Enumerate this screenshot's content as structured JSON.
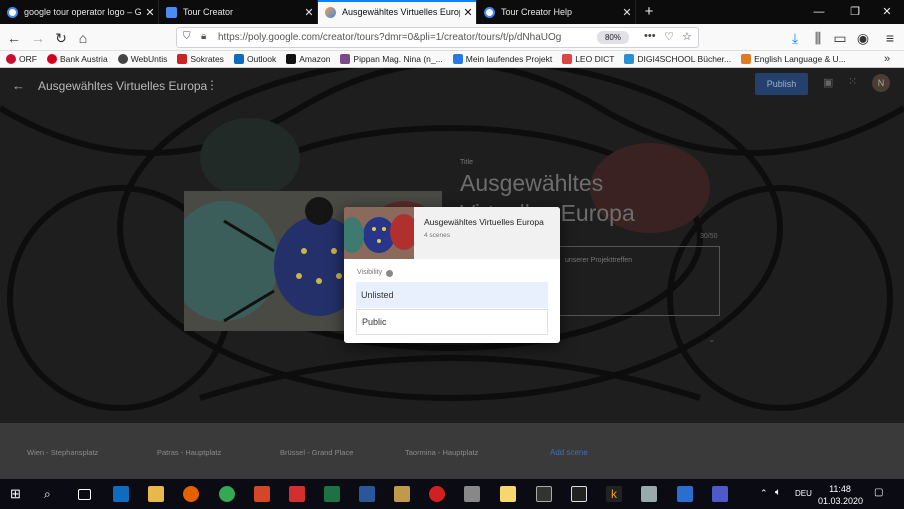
{
  "tabs": [
    {
      "title": "google tour operator logo – Go",
      "fav_color": "#4285f4"
    },
    {
      "title": "Tour Creator",
      "fav_color": "#4c8bf5"
    },
    {
      "title": "Ausgewähltes Virtuelles Europa",
      "fav_color": "#f2a33a"
    },
    {
      "title": "Tour Creator Help",
      "fav_color": "#4285f4"
    }
  ],
  "url": "https://poly.google.com/creator/tours?dmr=0&pli=1/creator/tours/t/p/dNhaUOg",
  "zoom": "80%",
  "bookmarks": [
    {
      "label": "ORF",
      "color": "#c8102e"
    },
    {
      "label": "Bank Austria",
      "color": "#d4001a"
    },
    {
      "label": "WebUntis",
      "color": "#444"
    },
    {
      "label": "Sokrates",
      "color": "#cc2222"
    },
    {
      "label": "Outlook",
      "color": "#0f6cbd"
    },
    {
      "label": "Amazon",
      "color": "#111"
    },
    {
      "label": "Pippan Mag. Nina (n_...",
      "color": "#7a4a8a"
    },
    {
      "label": "Mein laufendes Projekt",
      "color": "#2a7ae2"
    },
    {
      "label": "LEO DICT",
      "color": "#d44"
    },
    {
      "label": "DIGI4SCHOOL Bücher...",
      "color": "#2b8fd6"
    },
    {
      "label": "English Language & U...",
      "color": "#e07b25"
    }
  ],
  "app": {
    "tour_title": "Ausgewähltes Virtuelles Europa",
    "publish_label": "Publish",
    "avatar_letter": "N",
    "title_label": "Title",
    "big_title": "Ausgewähltes Virtuelles Europa",
    "char_count": "30/50",
    "description": "unserer Projekttreffen"
  },
  "scenes": [
    "Wien - Stephansplatz",
    "Patras - Hauptplatz",
    "Brüssel - Grand Place",
    "Taormina - Hauptplatz"
  ],
  "add_scene_label": "Add scene",
  "dialog": {
    "tour_name": "Ausgewähltes Virtuelles Europa",
    "scene_count": "4 scenes",
    "visibility_label": "Visibility",
    "options": [
      "Unlisted",
      "Public"
    ]
  },
  "taskbar": {
    "lang": "DEU",
    "time": "11:48",
    "date": "01.03.2020"
  }
}
